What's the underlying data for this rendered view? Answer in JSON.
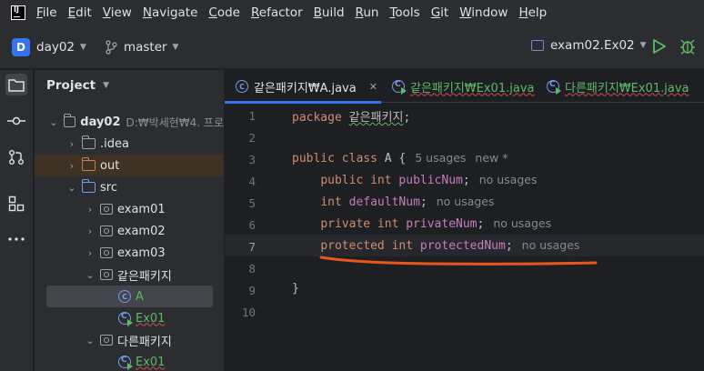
{
  "menubar": {
    "items": [
      {
        "label": "File",
        "mnemonic": "F",
        "rest": "ile"
      },
      {
        "label": "Edit",
        "mnemonic": "E",
        "rest": "dit"
      },
      {
        "label": "View",
        "mnemonic": "V",
        "rest": "iew"
      },
      {
        "label": "Navigate",
        "mnemonic": "N",
        "rest": "avigate"
      },
      {
        "label": "Code",
        "mnemonic": "C",
        "rest": "ode"
      },
      {
        "label": "Refactor",
        "mnemonic": "R",
        "rest": "efactor"
      },
      {
        "label": "Build",
        "mnemonic": "B",
        "rest": "uild"
      },
      {
        "label": "Run",
        "mnemonic": "R",
        "rest": "un"
      },
      {
        "label": "Tools",
        "mnemonic": "T",
        "rest": "ools"
      },
      {
        "label": "Git",
        "mnemonic": "G",
        "rest": "it"
      },
      {
        "label": "Window",
        "mnemonic": "W",
        "rest": "indow"
      },
      {
        "label": "Help",
        "mnemonic": "H",
        "rest": "elp"
      }
    ]
  },
  "toolbar": {
    "project_badge": "D",
    "project_name": "day02",
    "branch_name": "master",
    "run_config": "exam02.Ex02"
  },
  "project_panel": {
    "title": "Project",
    "tree": [
      {
        "indent": 0,
        "arrow": "⌄",
        "icon": "folder",
        "label": "day02",
        "bold": true,
        "path": "D:₩박세현₩4. 프로"
      },
      {
        "indent": 1,
        "arrow": "›",
        "icon": "folder",
        "label": ".idea"
      },
      {
        "indent": 1,
        "arrow": "›",
        "icon": "folder-orange",
        "label": "out"
      },
      {
        "indent": 1,
        "arrow": "⌄",
        "icon": "folder-blue",
        "label": "src"
      },
      {
        "indent": 2,
        "arrow": "›",
        "icon": "package",
        "label": "exam01"
      },
      {
        "indent": 2,
        "arrow": "›",
        "icon": "package",
        "label": "exam02"
      },
      {
        "indent": 2,
        "arrow": "›",
        "icon": "package",
        "label": "exam03"
      },
      {
        "indent": 2,
        "arrow": "⌄",
        "icon": "package",
        "label": "같은패키지"
      },
      {
        "indent": 3,
        "arrow": "",
        "icon": "class",
        "label": "A",
        "selected": true
      },
      {
        "indent": 3,
        "arrow": "",
        "icon": "main-class",
        "label": "Ex01"
      },
      {
        "indent": 2,
        "arrow": "⌄",
        "icon": "package",
        "label": "다른패키지"
      },
      {
        "indent": 3,
        "arrow": "",
        "icon": "main-class",
        "label": "Ex01"
      }
    ]
  },
  "editor": {
    "tabs": [
      {
        "label": "같은패키지₩A.java",
        "active": true,
        "close": "✕"
      },
      {
        "label": "같은패키지₩Ex01.java",
        "active": false
      },
      {
        "label": "다른패키지₩Ex01.java",
        "active": false
      }
    ],
    "line_numbers": [
      "1",
      "2",
      "3",
      "4",
      "5",
      "6",
      "7",
      "8",
      "9",
      "10"
    ],
    "current_line": "7",
    "code": {
      "line1_kw": "package",
      "line1_pkg": "같은패키지",
      "line1_end": ";",
      "line3_kw": "public class",
      "line3_name": "A {",
      "line3_hint1": "5 usages",
      "line3_hint2": "new *",
      "line4_kw": "public int",
      "line4_field": "publicNum",
      "line4_end": ";",
      "line4_hint": "no usages",
      "line5_kw": "int",
      "line5_field": "defaultNum",
      "line5_end": ";",
      "line5_hint": "no usages",
      "line6_kw": "private int",
      "line6_field": "privateNum",
      "line6_end": ";",
      "line6_hint": "no usages",
      "line7_kw": "protected int",
      "line7_field": "protectedNum",
      "line7_end": ";",
      "line7_hint": "no usages",
      "line9_text": "}"
    }
  },
  "colors": {
    "accent": "#3574f0",
    "annotation": "#e8561a",
    "keyword": "#cf8e6d",
    "field": "#c77dbb"
  }
}
